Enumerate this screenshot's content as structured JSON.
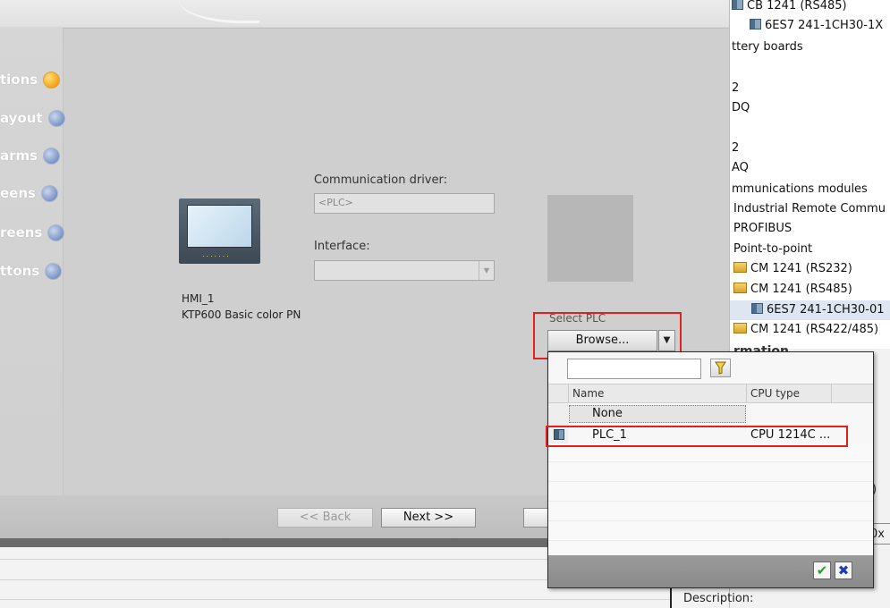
{
  "wizard": {
    "steps": [
      {
        "label": "tions",
        "active": true
      },
      {
        "label": "ayout",
        "active": false
      },
      {
        "label": "arms",
        "active": false
      },
      {
        "label": "eens",
        "active": false
      },
      {
        "label": "reens",
        "active": false
      },
      {
        "label": "ttons",
        "active": false
      }
    ],
    "device": {
      "name": "HMI_1",
      "type": "KTP600 Basic color PN",
      "keys": "......."
    },
    "comm_driver_label": "Communication driver:",
    "comm_driver_value": "<PLC>",
    "interface_label": "Interface:",
    "select_plc_label": "Select PLC",
    "browse_label": "Browse...",
    "back_label": "<< Back",
    "next_label": "Next >>"
  },
  "catalog": {
    "items": [
      {
        "text": "CB 1241 (RS485)",
        "icon": "module-icon"
      },
      {
        "text": "6ES7 241-1CH30-1X",
        "icon": "module-icon"
      },
      {
        "text": "ttery boards",
        "icon": ""
      },
      {
        "text": "2",
        "icon": ""
      },
      {
        "text": "DQ",
        "icon": ""
      },
      {
        "text": "2",
        "icon": ""
      },
      {
        "text": "AQ",
        "icon": ""
      },
      {
        "text": "mmunications modules",
        "icon": ""
      },
      {
        "text": "Industrial Remote Commu",
        "icon": ""
      },
      {
        "text": "PROFIBUS",
        "icon": ""
      },
      {
        "text": "Point-to-point",
        "icon": ""
      },
      {
        "text": "CM 1241 (RS232)",
        "icon": "folder-module-icon"
      },
      {
        "text": "CM 1241 (RS485)",
        "icon": "folder-module-icon"
      },
      {
        "text": "6ES7 241-1CH30-01",
        "icon": "module-icon"
      },
      {
        "text": "CM 1241 (RS422/485)",
        "icon": "folder-module-icon"
      }
    ],
    "info_heading": "rmation",
    "paren": ")",
    "ox": "0x",
    "description_label": "Description:"
  },
  "popup": {
    "columns": {
      "name": "Name",
      "cpu_type": "CPU type"
    },
    "rows": [
      {
        "name": "None",
        "cpu": ""
      },
      {
        "name": "PLC_1",
        "cpu": "CPU 1214C ..."
      }
    ],
    "ok_glyph": "✔",
    "cancel_glyph": "✖"
  },
  "colors": {
    "highlight_red": "#e1201f",
    "active_step": "#f4a21a"
  }
}
